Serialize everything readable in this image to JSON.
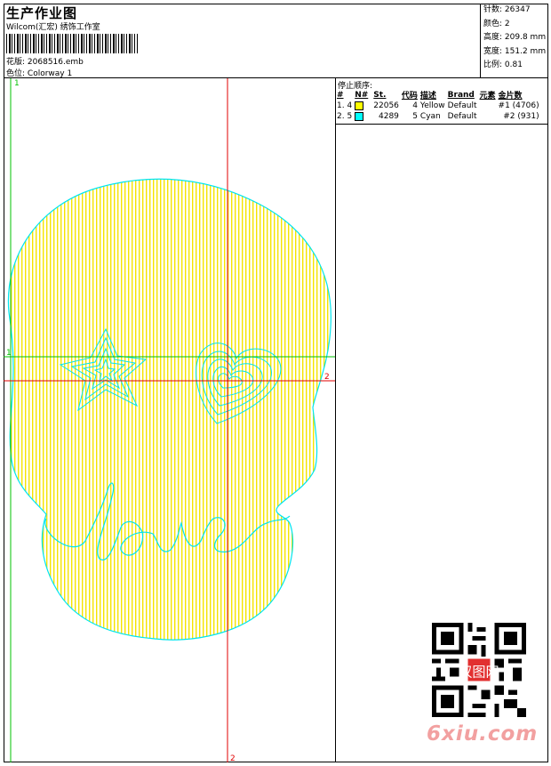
{
  "header": {
    "title": "生产作业图",
    "company": "Wilcom(汇宏) 绣饰工作室",
    "design_label": "花版:",
    "design_value": "2068516.emb",
    "colorway_label": "色位:",
    "colorway_value": "Colorway 1"
  },
  "stats": [
    {
      "label": "针数:",
      "value": "26347"
    },
    {
      "label": "颜色:",
      "value": "2"
    },
    {
      "label": "高度:",
      "value": "209.8 mm"
    },
    {
      "label": "宽度:",
      "value": "151.2 mm"
    },
    {
      "label": "比例:",
      "value": "0.81"
    }
  ],
  "stop_sequence": {
    "title": "停止顺序:",
    "columns": [
      "#",
      "N#",
      "",
      "St.",
      "代码",
      "描述",
      "Brand",
      "元素",
      "金片数"
    ],
    "rows": [
      {
        "idx": "1. 4",
        "color": "#ffff00",
        "stitches": "22056",
        "code": "4",
        "desc": "Yellow",
        "brand": "Default",
        "element": "",
        "sequin": "#1 (4706)"
      },
      {
        "idx": "2. 5",
        "color": "#00ffff",
        "stitches": "4289",
        "code": "5",
        "desc": "Cyan",
        "brand": "Default",
        "element": "",
        "sequin": "#2 (931)"
      }
    ]
  },
  "markers": {
    "top_1": "1",
    "left_1": "1",
    "right_2": "2",
    "bottom_2": "2"
  },
  "colors": {
    "fill": "#ffff00",
    "outline": "#00e5ee",
    "guide_green": "#00c000",
    "guide_red": "#e00000",
    "watermark": "#f2a0a0"
  },
  "watermark": "6xiu.com",
  "seal_text": "汉图网"
}
